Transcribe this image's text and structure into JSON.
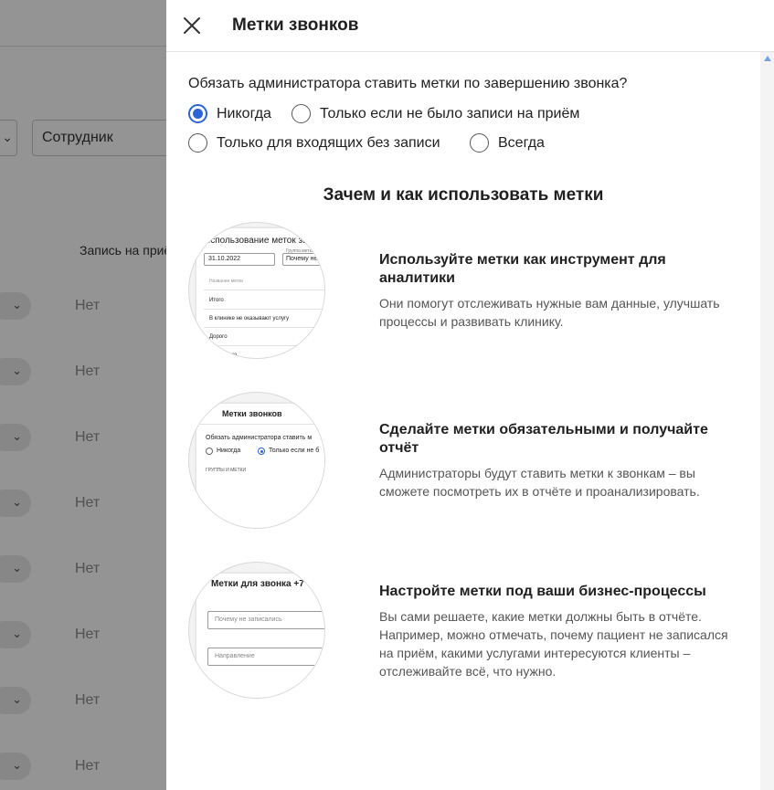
{
  "background": {
    "employee_select": "Сотрудник",
    "column_header": "Запись на приём",
    "row_value": "Нет",
    "rows": [
      "Нет",
      "Нет",
      "Нет",
      "Нет",
      "Нет",
      "Нет",
      "Нет",
      "Нет"
    ]
  },
  "drawer": {
    "title": "Метки звонков",
    "question": "Обязать администратора ставить метки по завершению звонка?",
    "options": [
      {
        "label": "Никогда",
        "checked": true
      },
      {
        "label": "Только если не было записи на приём",
        "checked": false
      },
      {
        "label": "Только для входящих без записи",
        "checked": false
      },
      {
        "label": "Всегда",
        "checked": false
      }
    ],
    "section_title": "Зачем и как использовать метки",
    "features": [
      {
        "title": "Используйте метки как инструмент для аналитики",
        "text": "Они помогут отслеживать нужные вам данные, улучшать процессы и развивать клинику.",
        "mini": {
          "heading": "Использование меток звон",
          "date": "31.10.2022",
          "group_label": "Группа метки",
          "group_value": "Почему не з",
          "col_label": "Название метки",
          "items": [
            "Итого",
            "В клинике не оказывают услугу",
            "Дорого",
            "... рекламе"
          ]
        }
      },
      {
        "title": "Сделайте метки обязательными и получайте отчёт",
        "text": "Администраторы будут ставить метки к звонкам – вы сможете посмотреть их в отчёте и проанализировать.",
        "mini": {
          "heading": "Метки звонков",
          "question": "Обязать администратора ставить м",
          "opt1": "Никогда",
          "opt2": "Только если не б",
          "groups": "ГРУППЫ И МЕТКИ"
        }
      },
      {
        "title": "Настройте метки под ваши бизнес-процессы",
        "text": "Вы сами решаете, какие метки должны быть в отчёте. Например, можно отмечать, почему пациент не записался на приём, какими услугами интересуются клиенты – отслеживайте всё, что нужно.",
        "mini": {
          "heading": "Метки для звонка +7",
          "field1": "Почему не записались",
          "field2": "Направление"
        }
      }
    ]
  }
}
